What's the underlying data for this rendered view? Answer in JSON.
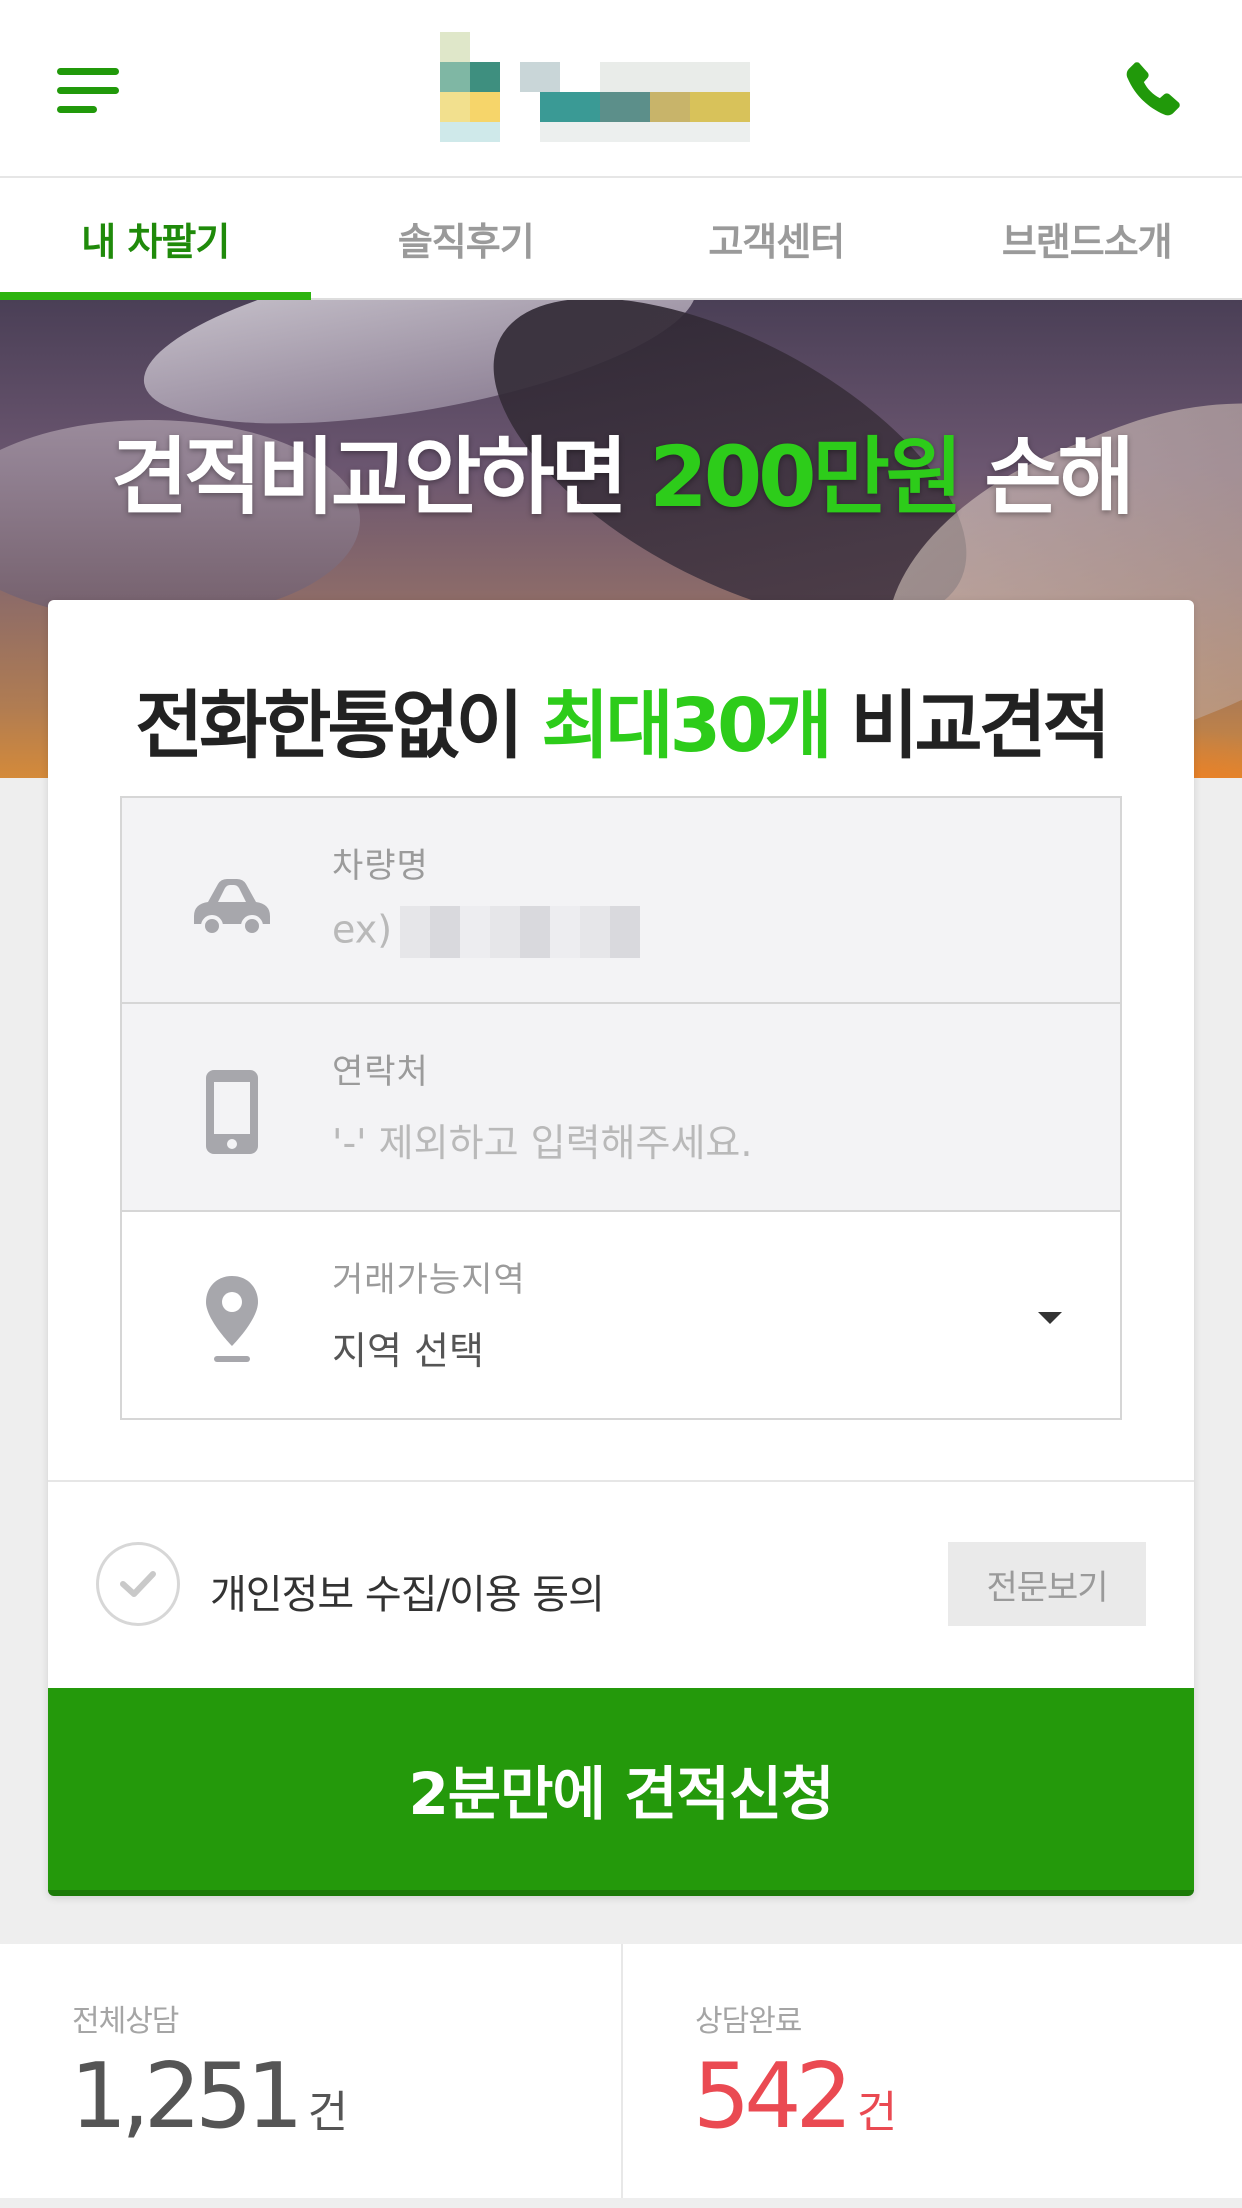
{
  "header": {
    "menu_icon": "hamburger-menu-icon",
    "phone_icon": "phone-icon"
  },
  "tabs": [
    {
      "label": "내 차팔기",
      "active": true
    },
    {
      "label": "솔직후기",
      "active": false
    },
    {
      "label": "고객센터",
      "active": false
    },
    {
      "label": "브랜드소개",
      "active": false
    }
  ],
  "hero": {
    "title_prefix": "견적비교안하면 ",
    "title_highlight": "200만원",
    "title_suffix": " 손해"
  },
  "form": {
    "title_prefix": "전화한통없이 ",
    "title_highlight": "최대30개",
    "title_suffix": " 비교견적",
    "car_name": {
      "label": "차량명",
      "placeholder": "ex)",
      "icon": "car-icon"
    },
    "contact": {
      "label": "연락처",
      "placeholder": "'-' 제외하고 입력해주세요.",
      "icon": "smartphone-icon"
    },
    "region": {
      "label": "거래가능지역",
      "value": "지역 선택",
      "icon": "location-pin-icon"
    },
    "agree_label": "개인정보 수집/이용 동의",
    "fulltext_button": "전문보기",
    "submit_button": "2분만에 견적신청"
  },
  "stats": {
    "total": {
      "label": "전체상담",
      "value": "1,251",
      "unit": "건"
    },
    "done": {
      "label": "상담완료",
      "value": "542",
      "unit": "건"
    }
  },
  "colors": {
    "brand_green": "#24990b",
    "highlight_green": "#2dcc1a",
    "accent_red": "#ea4a52"
  }
}
